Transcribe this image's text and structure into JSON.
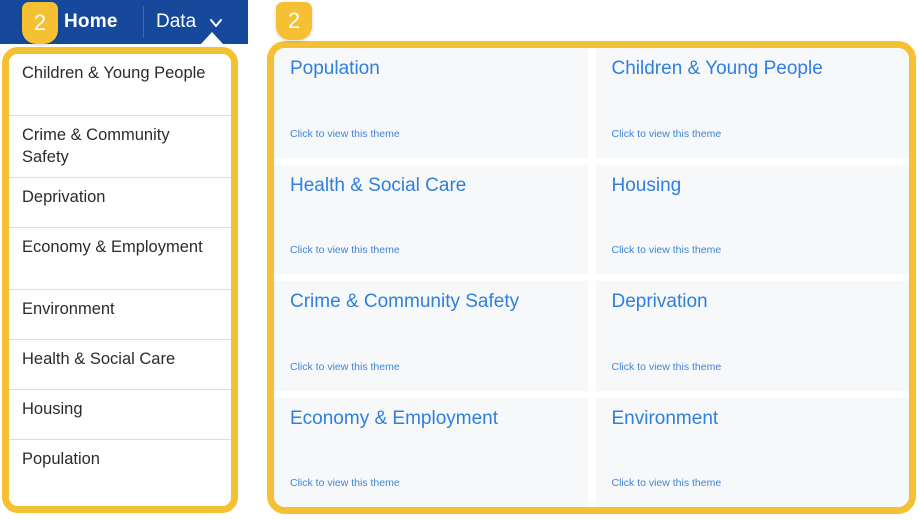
{
  "colors": {
    "nav_background": "#16499b",
    "highlight_border": "#f5c132",
    "badge_background": "#f5c132",
    "card_background": "#f7f8f9",
    "card_title": "#2e7fe0",
    "card_link": "#3f84d6"
  },
  "annotations": {
    "sidebar_badge": "2",
    "cards_badge": "2"
  },
  "navbar": {
    "items": [
      {
        "label": "Home",
        "active": true
      },
      {
        "label": "Data",
        "active": false
      }
    ],
    "home_label": "Home",
    "data_label": "Data",
    "chevron_icon": "chevron-down-icon"
  },
  "sidebar": {
    "items": [
      {
        "label": "Children & Young People",
        "lines": 2
      },
      {
        "label": "Crime & Community Safety",
        "lines": 2
      },
      {
        "label": "Deprivation",
        "lines": 1
      },
      {
        "label": "Economy & Employment",
        "lines": 2
      },
      {
        "label": "Environment",
        "lines": 1
      },
      {
        "label": "Health & Social Care",
        "lines": 1
      },
      {
        "label": "Housing",
        "lines": 1
      },
      {
        "label": "Population",
        "lines": 1
      }
    ]
  },
  "themes": {
    "link_text": "Click to view this theme",
    "cards": [
      {
        "title": "Population",
        "link": "Click to view this theme"
      },
      {
        "title": "Children & Young People",
        "link": "Click to view this theme"
      },
      {
        "title": "Health & Social Care",
        "link": "Click to view this theme"
      },
      {
        "title": "Housing",
        "link": "Click to view this theme"
      },
      {
        "title": "Crime & Community Safety",
        "link": "Click to view this theme"
      },
      {
        "title": "Deprivation",
        "link": "Click to view this theme"
      },
      {
        "title": "Economy & Employment",
        "link": "Click to view this theme"
      },
      {
        "title": "Environment",
        "link": "Click to view this theme"
      }
    ]
  }
}
